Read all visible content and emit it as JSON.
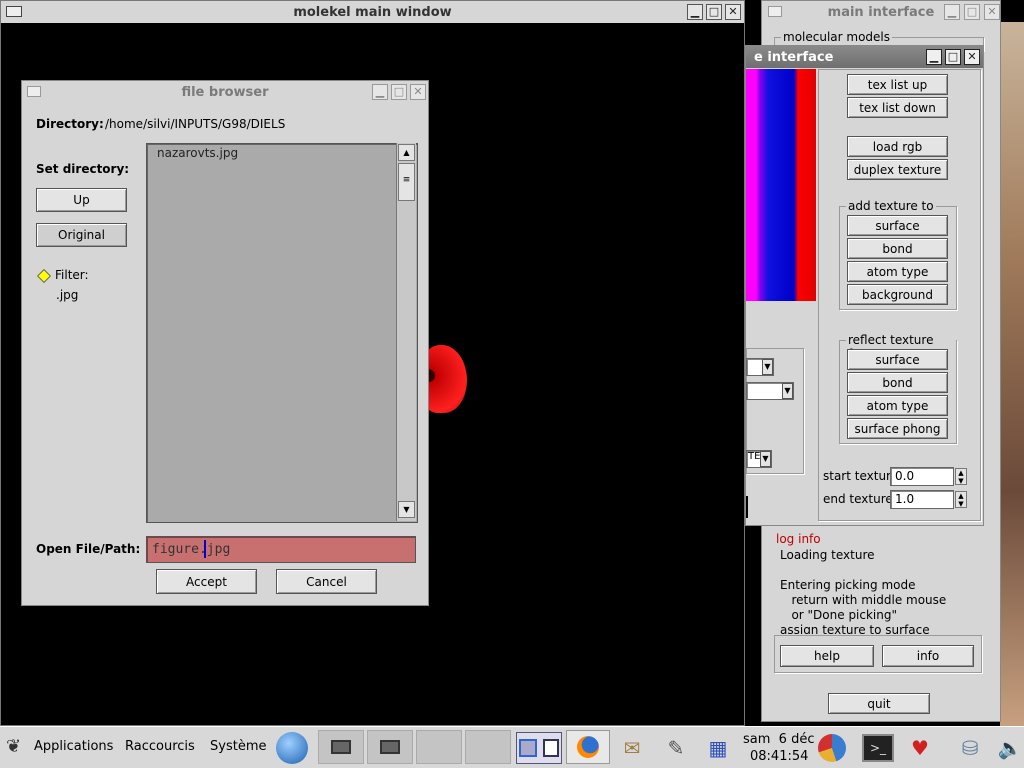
{
  "main_window": {
    "title": "molekel main window"
  },
  "file_browser": {
    "title": "file browser",
    "directory_label": "Directory:",
    "directory_path": "/home/silvi/INPUTS/G98/DIELS",
    "set_directory_label": "Set directory:",
    "up_label": "Up",
    "original_label": "Original",
    "filter_label": "Filter:",
    "filter_value": ".jpg",
    "files": [
      "nazarovts.jpg"
    ],
    "open_label": "Open File/Path:",
    "path_value": "figure.jpg",
    "accept_label": "Accept",
    "cancel_label": "Cancel"
  },
  "main_interface": {
    "title": "main interface",
    "molecular_models_label": "molecular models",
    "log_info_label": "log info",
    "log_lines": [
      "Loading texture",
      "",
      "Entering picking mode",
      "   return with middle mouse",
      "   or \"Done picking\"",
      "assign texture to surface"
    ],
    "help_label": "help",
    "info_label": "info",
    "quit_label": "quit"
  },
  "texture_interface": {
    "title_visible": "e interface",
    "tex_list_up": "tex list up",
    "tex_list_down": "tex list down",
    "load_rgb": "load rgb",
    "duplex_texture": "duplex texture",
    "add_texture_group": "add texture to",
    "add_items": [
      "surface",
      "bond",
      "atom type",
      "background"
    ],
    "reflect_group": "reflect texture from",
    "reflect_items": [
      "surface",
      "bond",
      "atom type",
      "surface phong"
    ],
    "start_texture_label": "start texture",
    "start_texture_value": "0.0",
    "end_texture_label": "end texture",
    "end_texture_value": "1.0",
    "combo3_text": "TE"
  },
  "taskbar": {
    "applications": "Applications",
    "raccourcis": "Raccourcis",
    "systeme": "Système",
    "date": "sam  6 déc",
    "time": "08:41:54"
  },
  "colors": {
    "accent_pink": "#c87070",
    "red": "#e00000",
    "blue": "#1010e0",
    "magenta": "#ff00ff"
  }
}
